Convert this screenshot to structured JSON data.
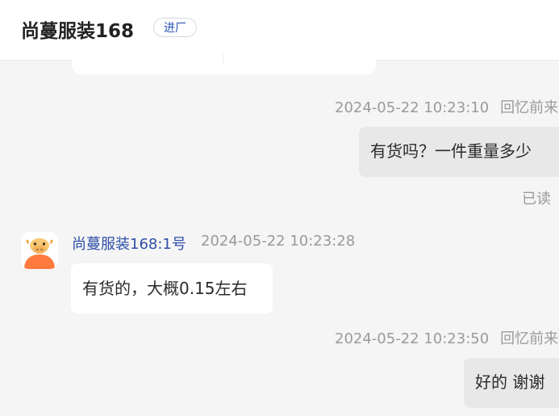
{
  "header": {
    "title": "尚蔓服装168",
    "badge": "进厂"
  },
  "messages": [
    {
      "direction": "outgoing",
      "time": "2024-05-22 10:23:10",
      "recall": "回忆前来",
      "text": "有货吗？一件重量多少",
      "status": "已读"
    },
    {
      "direction": "incoming",
      "sender": "尚蔓服装168:1号",
      "time": "2024-05-22 10:23:28",
      "text": "有货的，大概0.15左右"
    },
    {
      "direction": "outgoing",
      "time": "2024-05-22 10:23:50",
      "recall": "回忆前来",
      "text": "好的 谢谢"
    }
  ],
  "colors": {
    "background": "#f5f5f5",
    "header_bg": "#ffffff",
    "outgoing_bubble": "#e8e8e8",
    "incoming_bubble": "#ffffff",
    "sender_name": "#2f4fa8",
    "badge_text": "#2a56b3",
    "meta_text": "#9a9a9a",
    "avatar_accent": "#ff7a3d"
  },
  "icons": {
    "avatar": "cow-mascot-icon"
  }
}
